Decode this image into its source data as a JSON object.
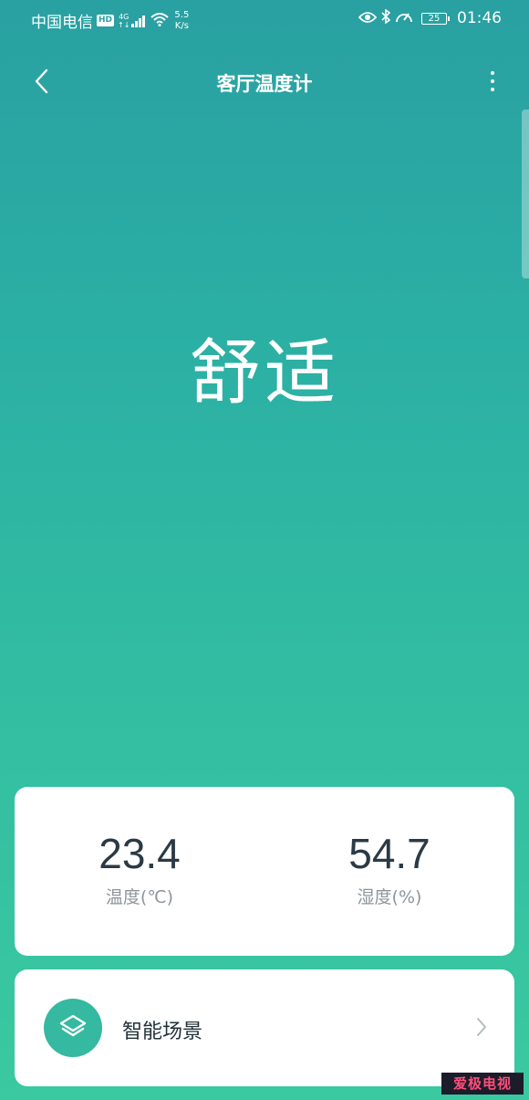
{
  "status_bar": {
    "carrier": "中国电信",
    "hd": "HD",
    "network": "4G",
    "network_sub": "↑↓",
    "speed_value": "5.5",
    "speed_unit": "K/s",
    "battery": "25",
    "time": "01:46"
  },
  "header": {
    "title": "客厅温度计"
  },
  "comfort": {
    "status": "舒适"
  },
  "readings": {
    "temperature": {
      "value": "23.4",
      "label": "温度(℃)"
    },
    "humidity": {
      "value": "54.7",
      "label": "湿度(%)"
    }
  },
  "scene": {
    "label": "智能场景"
  },
  "watermark": {
    "text": "爱极电视"
  },
  "icons": {
    "back": "chevron-left-icon",
    "more": "more-vertical-icon",
    "scene": "layers-icon",
    "chevron": "chevron-right-icon"
  },
  "colors": {
    "accent": "#35b9a0",
    "bg_top": "#29a0a2",
    "bg_bottom": "#3ac9a0"
  }
}
